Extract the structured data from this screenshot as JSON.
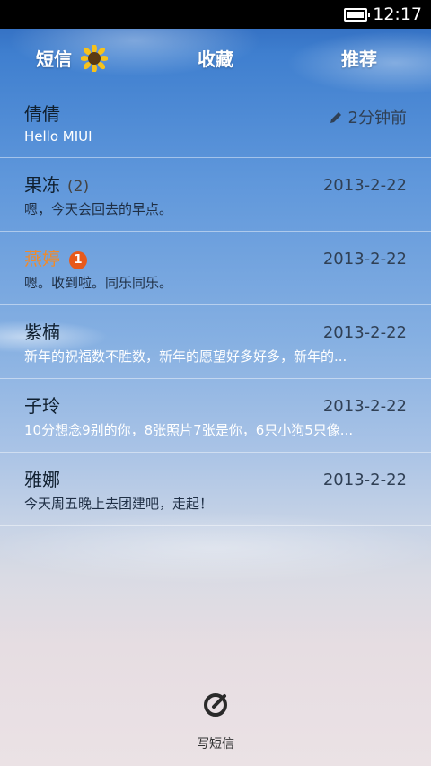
{
  "status": {
    "time": "12:17"
  },
  "tabs": [
    {
      "label": "短信"
    },
    {
      "label": "收藏"
    },
    {
      "label": "推荐"
    }
  ],
  "messages": [
    {
      "name": "倩倩",
      "preview": "Hello MIUI",
      "time": "2分钟前"
    },
    {
      "name": "果冻",
      "count": "(2)",
      "preview": "嗯，今天会回去的早点。",
      "time": "2013-2-22"
    },
    {
      "name": "燕婷",
      "badge": "1",
      "preview": "嗯。收到啦。同乐同乐。",
      "time": "2013-2-22"
    },
    {
      "name": "紫楠",
      "preview": "新年的祝福数不胜数，新年的愿望好多好多，新年的...",
      "time": "2013-2-22"
    },
    {
      "name": "子玲",
      "preview": "10分想念9别的你，8张照片7张是你，6只小狗5只像...",
      "time": "2013-2-22"
    },
    {
      "name": "雅娜",
      "preview": "今天周五晚上去团建吧，走起！",
      "time": "2013-2-22"
    }
  ],
  "compose": {
    "label": "写短信"
  },
  "colors": {
    "unread_name": "#f08a2a",
    "badge": "#e85a1b"
  }
}
